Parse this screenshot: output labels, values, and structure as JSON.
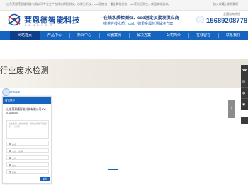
{
  "topbar": {
    "welcome": "山东莱恩德智能科技有限公司专业生产在线水质检测仪，水质分析仪，cod测定仪，重金属检测仪，atp荧光检测仪，欢迎来电咨询。",
    "links": "加入收藏 | 联系我们"
  },
  "header": {
    "logo_text": "莱恩德智能科技",
    "logo_en": "LANENDE",
    "slogan_line1": "在线水质检测仪、cod测定仪批发供应商",
    "slogan_line2": "提供在线水质、cod、德重金属检测解决方案",
    "hotline_label": "全国咨询热线",
    "hotline_number": "15689208778"
  },
  "nav": {
    "items": [
      {
        "label": "网站首页",
        "active": true
      },
      {
        "label": "产品中心",
        "active": false
      },
      {
        "label": "新闻中心",
        "active": false
      },
      {
        "label": "仪器案例",
        "active": false
      },
      {
        "label": "解决方案",
        "active": false
      },
      {
        "label": "公司简介",
        "active": false
      },
      {
        "label": "在线留言",
        "active": false
      },
      {
        "label": "联系我们",
        "active": false
      }
    ]
  },
  "banner": {
    "title": "行业废水检测",
    "next_arrow": "›"
  },
  "side_tools": {
    "icons": [
      "phone-icon",
      "chat-icon",
      "wechat-icon",
      "qq-icon"
    ],
    "top_icon": "arrow-up-icon"
  },
  "chat": {
    "online_label": "在线客服",
    "header_title": "留言提示",
    "message": "山东莱恩德智能科技有限公司400-0-688000",
    "textarea_placeholder": "请在此输入留言内容，我们会尽快与您联系。（必填）",
    "fields": [
      {
        "icon": "user-icon",
        "placeholder": "姓名"
      },
      {
        "icon": "phone-icon",
        "placeholder": "电话（必填）"
      },
      {
        "icon": "building-icon",
        "placeholder": "公司"
      },
      {
        "icon": "location-icon",
        "placeholder": "地址"
      },
      {
        "icon": "mail-icon",
        "placeholder": "邮箱"
      }
    ],
    "send_label": "留言"
  },
  "colors": {
    "brand_blue": "#1565c0",
    "nav_active": "#0d3f8a",
    "logo_blue": "#1a4fa0"
  }
}
